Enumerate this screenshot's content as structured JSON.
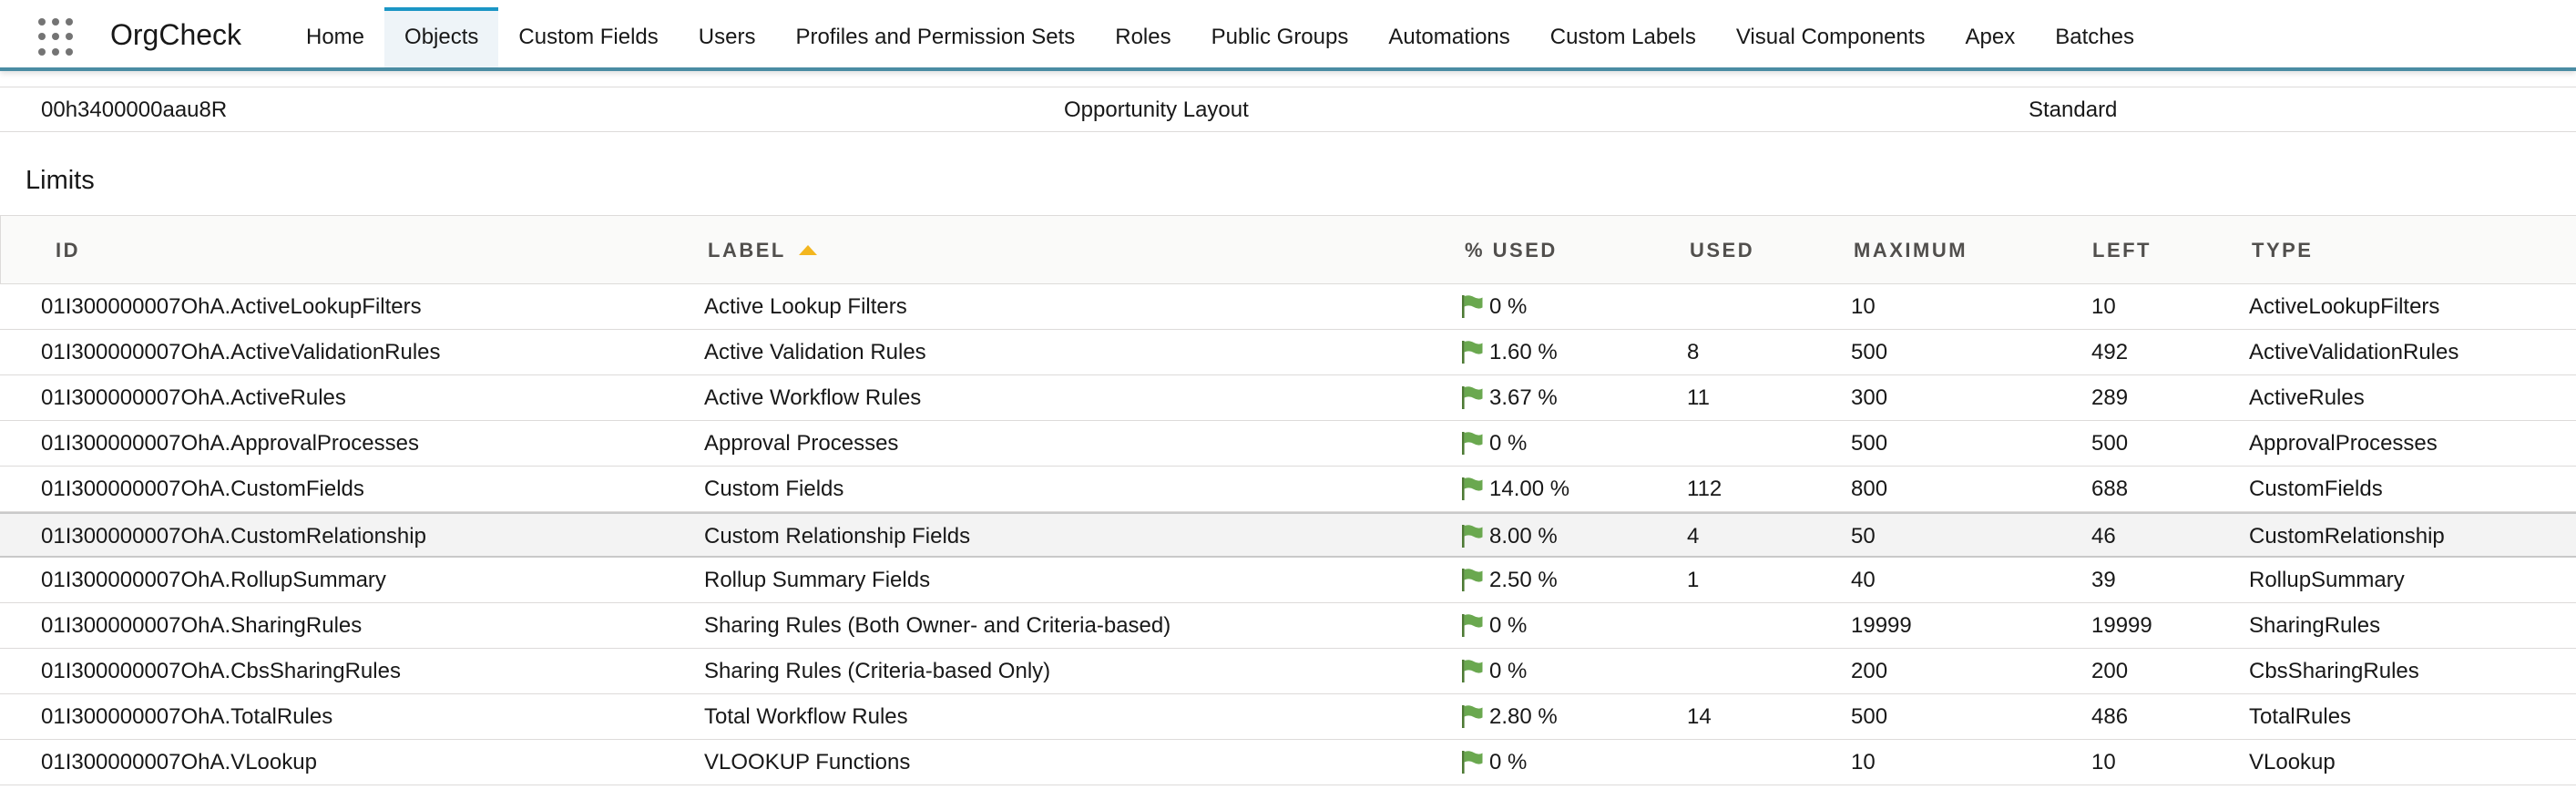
{
  "app": {
    "name": "OrgCheck"
  },
  "nav": {
    "items": [
      {
        "label": "Home"
      },
      {
        "label": "Objects"
      },
      {
        "label": "Custom Fields"
      },
      {
        "label": "Users"
      },
      {
        "label": "Profiles and Permission Sets"
      },
      {
        "label": "Roles"
      },
      {
        "label": "Public Groups"
      },
      {
        "label": "Automations"
      },
      {
        "label": "Custom Labels"
      },
      {
        "label": "Visual Components"
      },
      {
        "label": "Apex"
      },
      {
        "label": "Batches"
      }
    ],
    "active": "Objects"
  },
  "layout_row": {
    "id": "00h3400000aau8R",
    "name": "Opportunity Layout",
    "type": "Standard"
  },
  "limits": {
    "title": "Limits",
    "columns": {
      "id": "ID",
      "label": "LABEL",
      "pct_used": "% USED",
      "used": "USED",
      "maximum": "MAXIMUM",
      "left": "LEFT",
      "type": "TYPE"
    },
    "sort": {
      "column": "LABEL",
      "direction": "ascending"
    },
    "flag_color": "#6aa84f",
    "highlight_color": "#f3f3f3",
    "rows": [
      {
        "id": "01I300000007OhA.ActiveLookupFilters",
        "label": "Active Lookup Filters",
        "pct_used": "0 %",
        "used": "",
        "maximum": "10",
        "left": "10",
        "type": "ActiveLookupFilters"
      },
      {
        "id": "01I300000007OhA.ActiveValidationRules",
        "label": "Active Validation Rules",
        "pct_used": "1.60 %",
        "used": "8",
        "maximum": "500",
        "left": "492",
        "type": "ActiveValidationRules"
      },
      {
        "id": "01I300000007OhA.ActiveRules",
        "label": "Active Workflow Rules",
        "pct_used": "3.67 %",
        "used": "11",
        "maximum": "300",
        "left": "289",
        "type": "ActiveRules"
      },
      {
        "id": "01I300000007OhA.ApprovalProcesses",
        "label": "Approval Processes",
        "pct_used": "0 %",
        "used": "",
        "maximum": "500",
        "left": "500",
        "type": "ApprovalProcesses"
      },
      {
        "id": "01I300000007OhA.CustomFields",
        "label": "Custom Fields",
        "pct_used": "14.00 %",
        "used": "112",
        "maximum": "800",
        "left": "688",
        "type": "CustomFields"
      },
      {
        "id": "01I300000007OhA.CustomRelationship",
        "label": "Custom Relationship Fields",
        "pct_used": "8.00 %",
        "used": "4",
        "maximum": "50",
        "left": "46",
        "type": "CustomRelationship",
        "highlighted": true
      },
      {
        "id": "01I300000007OhA.RollupSummary",
        "label": "Rollup Summary Fields",
        "pct_used": "2.50 %",
        "used": "1",
        "maximum": "40",
        "left": "39",
        "type": "RollupSummary"
      },
      {
        "id": "01I300000007OhA.SharingRules",
        "label": "Sharing Rules (Both Owner- and Criteria-based)",
        "pct_used": "0 %",
        "used": "",
        "maximum": "19999",
        "left": "19999",
        "type": "SharingRules"
      },
      {
        "id": "01I300000007OhA.CbsSharingRules",
        "label": "Sharing Rules (Criteria-based Only)",
        "pct_used": "0 %",
        "used": "",
        "maximum": "200",
        "left": "200",
        "type": "CbsSharingRules"
      },
      {
        "id": "01I300000007OhA.TotalRules",
        "label": "Total Workflow Rules",
        "pct_used": "2.80 %",
        "used": "14",
        "maximum": "500",
        "left": "486",
        "type": "TotalRules"
      },
      {
        "id": "01I300000007OhA.VLookup",
        "label": "VLOOKUP Functions",
        "pct_used": "0 %",
        "used": "",
        "maximum": "10",
        "left": "10",
        "type": "VLookup"
      }
    ]
  }
}
